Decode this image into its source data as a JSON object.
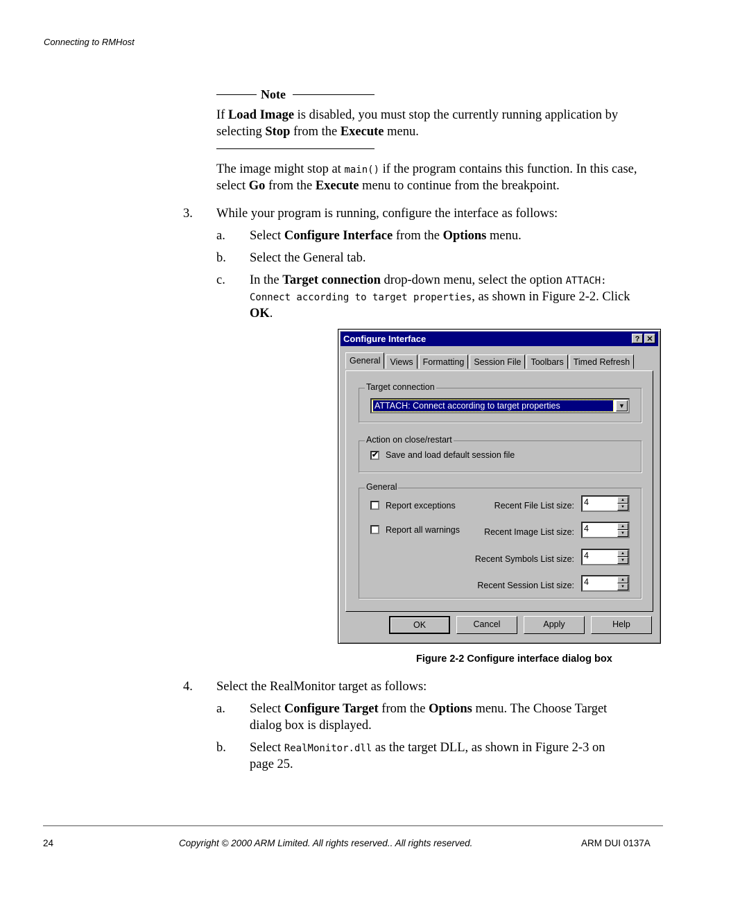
{
  "running_header": "Connecting to RMHost",
  "note": {
    "heading": "Note",
    "body": [
      {
        "t": "If ",
        "b": false
      },
      {
        "t": "Load Image",
        "b": true
      },
      {
        "t": " is disabled, you must stop the currently running application by",
        "b": false
      }
    ],
    "line2": [
      {
        "t": "selecting ",
        "b": false
      },
      {
        "t": "Stop",
        "b": true
      },
      {
        "t": " from the ",
        "b": false
      },
      {
        "t": "Execute",
        "b": true
      },
      {
        "t": " menu.",
        "b": false
      }
    ]
  },
  "para_main": {
    "l1_pre": "The image might stop at ",
    "l1_code": "main()",
    "l1_post": " if the program contains this function. In this case,",
    "l2": [
      {
        "t": "select ",
        "b": false
      },
      {
        "t": "Go",
        "b": true
      },
      {
        "t": " from the ",
        "b": false
      },
      {
        "t": "Execute",
        "b": true
      },
      {
        "t": " menu to continue from the breakpoint.",
        "b": false
      }
    ]
  },
  "step3": {
    "num": "3.",
    "text": "While your program is running, configure the interface as follows:",
    "a": {
      "label": "a.",
      "parts": [
        {
          "t": "Select ",
          "b": false
        },
        {
          "t": "Configure Interface",
          "b": true
        },
        {
          "t": " from the ",
          "b": false
        },
        {
          "t": "Options",
          "b": true
        },
        {
          "t": " menu.",
          "b": false
        }
      ]
    },
    "b": {
      "label": "b.",
      "text": "Select the General tab."
    },
    "c": {
      "label": "c.",
      "pre": "In the ",
      "bold": "Target connection",
      "mid": " drop-down menu, select the option ",
      "code1": "ATTACH:",
      "code2": "Connect according to target properties",
      "post": ", as shown in Figure 2-2. Click",
      "ok": "OK",
      "end": "."
    }
  },
  "dialog": {
    "title": "Configure Interface",
    "help_btn": "?",
    "close_btn": "✕",
    "tabs": [
      "General",
      "Views",
      "Formatting",
      "Session File",
      "Toolbars",
      "Timed Refresh"
    ],
    "target_group": "Target connection",
    "target_value": "ATTACH:  Connect according to target properties",
    "action_group": "Action on close/restart",
    "save_session_label": "Save and load default session file",
    "save_session_checked": true,
    "general_group": "General",
    "report_exceptions": {
      "label": "Report exceptions",
      "checked": false
    },
    "report_warnings": {
      "label": "Report all warnings",
      "checked": false
    },
    "spinners": [
      {
        "label": "Recent File List size:",
        "value": "4"
      },
      {
        "label": "Recent Image List size:",
        "value": "4"
      },
      {
        "label": "Recent Symbols List size:",
        "value": "4"
      },
      {
        "label": "Recent Session List size:",
        "value": "4"
      }
    ],
    "buttons": {
      "ok": "OK",
      "cancel": "Cancel",
      "apply": "Apply",
      "help": "Help"
    }
  },
  "figure_caption": "Figure 2-2 Configure interface dialog box",
  "step4": {
    "num": "4.",
    "text": "Select the RealMonitor target as follows:",
    "a": {
      "label": "a.",
      "parts": [
        {
          "t": "Select ",
          "b": false
        },
        {
          "t": "Configure Target",
          "b": true
        },
        {
          "t": " from the ",
          "b": false
        },
        {
          "t": "Options",
          "b": true
        },
        {
          "t": " menu. The Choose Target",
          "b": false
        }
      ],
      "line2": "dialog box is displayed."
    },
    "b": {
      "label": "b.",
      "pre": "Select ",
      "code": "RealMonitor.dll",
      "post": " as the target DLL, as shown in Figure 2-3 on",
      "line2": "page 25."
    }
  },
  "footer": {
    "page": "24",
    "copyright": "Copyright © 2000 ARM Limited. All rights reserved.. All rights reserved.",
    "doc_id": "ARM DUI 0137A"
  }
}
